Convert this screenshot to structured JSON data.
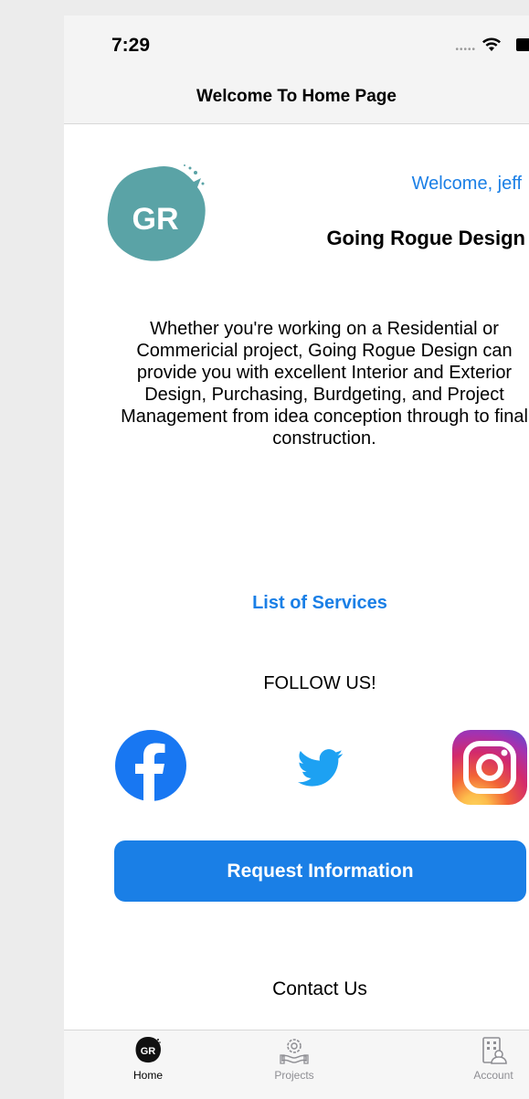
{
  "status_bar": {
    "time": "7:29"
  },
  "nav": {
    "title": "Welcome To Home Page"
  },
  "header": {
    "logo_text": "GR",
    "welcome": "Welcome, jeff",
    "company": "Going Rogue Design"
  },
  "intro": "Whether you're working on a Residential or Commericial project, Going Rogue Design can provide you with excellent Interior and Exterior Design, Purchasing, Burdgeting, and Project Management from idea conception through to final construction.",
  "services_link": "List of Services",
  "follow_label": "FOLLOW US!",
  "social": {
    "facebook_icon": "facebook-icon",
    "twitter_icon": "twitter-icon",
    "instagram_icon": "instagram-icon"
  },
  "request_button": "Request Information",
  "contact_link": "Contact Us",
  "tabs": [
    {
      "label": "Home",
      "icon": "logo-icon",
      "active": true
    },
    {
      "label": "Projects",
      "icon": "projects-icon",
      "active": false
    },
    {
      "label": "Account",
      "icon": "account-icon",
      "active": false
    }
  ],
  "colors": {
    "accent": "#1a7fe6",
    "logo_teal": "#5aa3a6",
    "facebook": "#1877f2",
    "twitter": "#1da1f2"
  }
}
